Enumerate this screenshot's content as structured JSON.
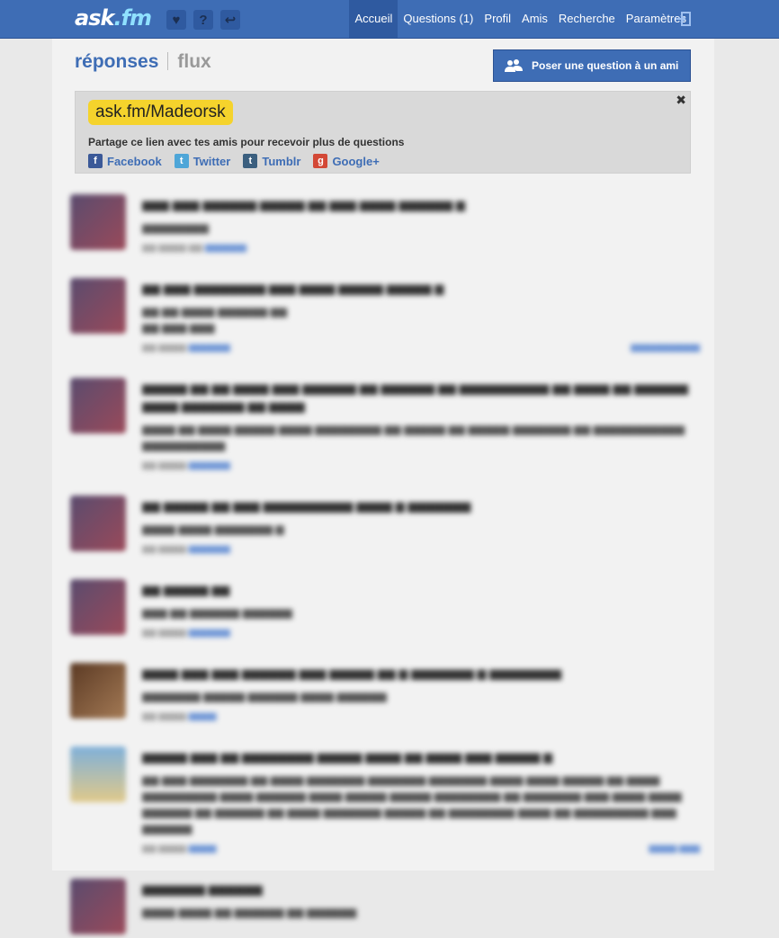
{
  "header": {
    "logo": {
      "ask": "ask",
      "fm": ".fm"
    },
    "icons": [
      "heart-icon",
      "question-icon",
      "reply-icon"
    ],
    "nav": [
      "Accueil",
      "Questions (1)",
      "Profil",
      "Amis",
      "Recherche",
      "Paramètres"
    ],
    "active_nav": "Accueil"
  },
  "main": {
    "title_responses": "réponses",
    "title_flux": "flux",
    "ask_button": "Poser une question à un ami"
  },
  "share": {
    "url": "ask.fm/Madeorsk",
    "text": "Partage ce lien avec tes amis pour recevoir plus de questions",
    "links": [
      "Facebook",
      "Twitter",
      "Tumblr",
      "Google+"
    ]
  },
  "colors": {
    "brand": "#3e6db5",
    "url_highlight": "#f5d32c",
    "facebook": "#3b5998",
    "twitter": "#4ea6d8",
    "tumblr": "#3b5f7f",
    "google": "#d34836"
  }
}
